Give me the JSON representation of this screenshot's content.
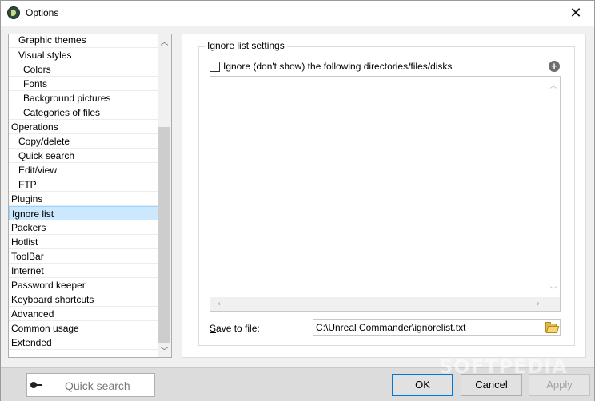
{
  "window": {
    "title": "Options",
    "close_glyph": "✕"
  },
  "tree": {
    "items": [
      {
        "label": "Graphic themes",
        "level": 1
      },
      {
        "label": "Visual styles",
        "level": 1
      },
      {
        "label": "Colors",
        "level": 2
      },
      {
        "label": "Fonts",
        "level": 2
      },
      {
        "label": "Background pictures",
        "level": 2
      },
      {
        "label": "Categories of files",
        "level": 2
      },
      {
        "label": "Operations",
        "level": 0
      },
      {
        "label": "Copy/delete",
        "level": 1
      },
      {
        "label": "Quick search",
        "level": 1
      },
      {
        "label": "Edit/view",
        "level": 1
      },
      {
        "label": "FTP",
        "level": 1
      },
      {
        "label": "Plugins",
        "level": 0
      },
      {
        "label": "Ignore list",
        "level": 0,
        "selected": true
      },
      {
        "label": "Packers",
        "level": 0
      },
      {
        "label": "Hotlist",
        "level": 0
      },
      {
        "label": "ToolBar",
        "level": 0
      },
      {
        "label": "Internet",
        "level": 0
      },
      {
        "label": "Password keeper",
        "level": 0
      },
      {
        "label": "Keyboard shortcuts",
        "level": 0
      },
      {
        "label": "Advanced",
        "level": 0
      },
      {
        "label": "Common usage",
        "level": 0
      },
      {
        "label": "Extended",
        "level": 0
      }
    ],
    "scroll_up": "︿",
    "scroll_down": "﹀"
  },
  "ignore": {
    "group_title": "Ignore list settings",
    "checkbox_label": "Ignore (don't show) the following directories/files/disks",
    "checkbox_checked": false,
    "add_glyph": "+",
    "list_items": [],
    "save_label_prefix": "S",
    "save_label_rest": "ave to file:",
    "save_path": "C:\\Unreal Commander\\ignorelist.txt"
  },
  "bottom": {
    "quick_search_placeholder": "Quick search",
    "ok_label": "OK",
    "cancel_label": "Cancel",
    "apply_label": "Apply",
    "watermark": "SOFTPEDIA"
  },
  "colors": {
    "selection": "#cce8ff",
    "default_button_border": "#0078d7"
  }
}
